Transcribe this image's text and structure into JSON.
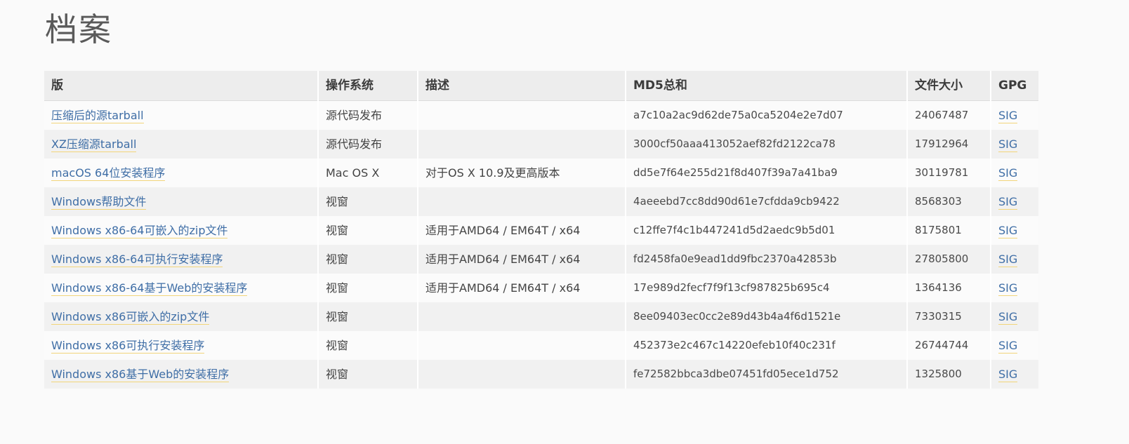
{
  "page": {
    "title": "档案"
  },
  "table": {
    "headers": {
      "version": "版",
      "os": "操作系统",
      "description": "描述",
      "md5": "MD5总和",
      "filesize": "文件大小",
      "gpg": "GPG"
    },
    "rows": [
      {
        "version": "压缩后的源tarball",
        "os": "源代码发布",
        "description": "",
        "md5": "a7c10a2ac9d62de75a0ca5204e2e7d07",
        "filesize": "24067487",
        "gpg": "SIG"
      },
      {
        "version": "XZ压缩源tarball",
        "os": "源代码发布",
        "description": "",
        "md5": "3000cf50aaa413052aef82fd2122ca78",
        "filesize": "17912964",
        "gpg": "SIG"
      },
      {
        "version": "macOS 64位安装程序",
        "os": "Mac OS X",
        "description": "对于OS X 10.9及更高版本",
        "md5": "dd5e7f64e255d21f8d407f39a7a41ba9",
        "filesize": "30119781",
        "gpg": "SIG"
      },
      {
        "version": "Windows帮助文件",
        "os": "视窗",
        "description": "",
        "md5": "4aeeebd7cc8dd90d61e7cfdda9cb9422",
        "filesize": "8568303",
        "gpg": "SIG"
      },
      {
        "version": "Windows x86-64可嵌入的zip文件",
        "os": "视窗",
        "description": "适用于AMD64 / EM64T / x64",
        "md5": "c12ffe7f4c1b447241d5d2aedc9b5d01",
        "filesize": "8175801",
        "gpg": "SIG"
      },
      {
        "version": "Windows x86-64可执行安装程序",
        "os": "视窗",
        "description": "适用于AMD64 / EM64T / x64",
        "md5": "fd2458fa0e9ead1dd9fbc2370a42853b",
        "filesize": "27805800",
        "gpg": "SIG"
      },
      {
        "version": "Windows x86-64基于Web的安装程序",
        "os": "视窗",
        "description": "适用于AMD64 / EM64T / x64",
        "md5": "17e989d2fecf7f9f13cf987825b695c4",
        "filesize": "1364136",
        "gpg": "SIG"
      },
      {
        "version": "Windows x86可嵌入的zip文件",
        "os": "视窗",
        "description": "",
        "md5": "8ee09403ec0cc2e89d43b4a4f6d1521e",
        "filesize": "7330315",
        "gpg": "SIG"
      },
      {
        "version": "Windows x86可执行安装程序",
        "os": "视窗",
        "description": "",
        "md5": "452373e2c467c14220efeb10f40c231f",
        "filesize": "26744744",
        "gpg": "SIG"
      },
      {
        "version": "Windows x86基于Web的安装程序",
        "os": "视窗",
        "description": "",
        "md5": "fe72582bbca3dbe07451fd05ece1d752",
        "filesize": "1325800",
        "gpg": "SIG"
      }
    ]
  }
}
